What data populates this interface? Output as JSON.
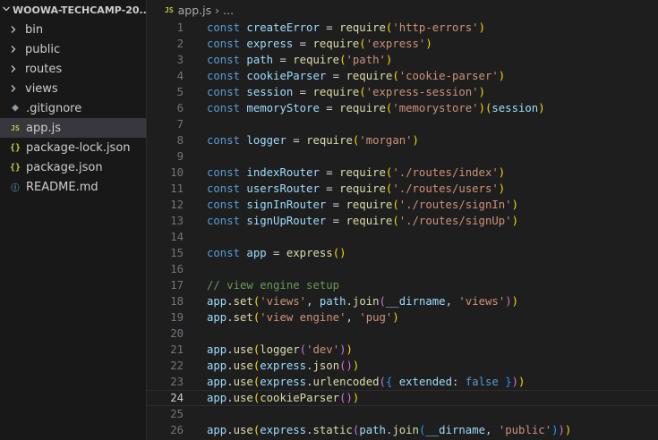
{
  "explorer": {
    "title": "WOOWA-TECHCAMP-20...",
    "items": [
      {
        "kind": "folder",
        "label": "bin"
      },
      {
        "kind": "folder",
        "label": "public"
      },
      {
        "kind": "folder",
        "label": "routes"
      },
      {
        "kind": "folder",
        "label": "views"
      },
      {
        "kind": "file",
        "icon": "git",
        "label": ".gitignore"
      },
      {
        "kind": "file",
        "icon": "js",
        "label": "app.js",
        "selected": true
      },
      {
        "kind": "file",
        "icon": "json",
        "label": "package-lock.json"
      },
      {
        "kind": "file",
        "icon": "json",
        "label": "package.json"
      },
      {
        "kind": "file",
        "icon": "info",
        "label": "README.md"
      }
    ]
  },
  "breadcrumb": {
    "file": "app.js",
    "rest": "..."
  },
  "icon_glyphs": {
    "js": "JS",
    "json": "{}",
    "git": "◆",
    "info": "ⓘ"
  },
  "current_line": 24,
  "code_lines": [
    [
      [
        "kw",
        "const "
      ],
      [
        "var",
        "createError"
      ],
      [
        "op",
        " = "
      ],
      [
        "fn",
        "require"
      ],
      [
        "br1",
        "("
      ],
      [
        "str",
        "'http-errors'"
      ],
      [
        "br1",
        ")"
      ]
    ],
    [
      [
        "kw",
        "const "
      ],
      [
        "var",
        "express"
      ],
      [
        "op",
        " = "
      ],
      [
        "fn",
        "require"
      ],
      [
        "br1",
        "("
      ],
      [
        "str",
        "'express'"
      ],
      [
        "br1",
        ")"
      ]
    ],
    [
      [
        "kw",
        "const "
      ],
      [
        "var",
        "path"
      ],
      [
        "op",
        " = "
      ],
      [
        "fn",
        "require"
      ],
      [
        "br1",
        "("
      ],
      [
        "str",
        "'path'"
      ],
      [
        "br1",
        ")"
      ]
    ],
    [
      [
        "kw",
        "const "
      ],
      [
        "var",
        "cookieParser"
      ],
      [
        "op",
        " = "
      ],
      [
        "fn",
        "require"
      ],
      [
        "br1",
        "("
      ],
      [
        "str",
        "'cookie-parser'"
      ],
      [
        "br1",
        ")"
      ]
    ],
    [
      [
        "kw",
        "const "
      ],
      [
        "var",
        "session"
      ],
      [
        "op",
        " = "
      ],
      [
        "fn",
        "require"
      ],
      [
        "br1",
        "("
      ],
      [
        "str",
        "'express-session'"
      ],
      [
        "br1",
        ")"
      ]
    ],
    [
      [
        "kw",
        "const "
      ],
      [
        "var",
        "memoryStore"
      ],
      [
        "op",
        " = "
      ],
      [
        "fn",
        "require"
      ],
      [
        "br1",
        "("
      ],
      [
        "str",
        "'memorystore'"
      ],
      [
        "br1",
        ")("
      ],
      [
        "var",
        "session"
      ],
      [
        "br1",
        ")"
      ]
    ],
    [],
    [
      [
        "kw",
        "const "
      ],
      [
        "var",
        "logger"
      ],
      [
        "op",
        " = "
      ],
      [
        "fn",
        "require"
      ],
      [
        "br1",
        "("
      ],
      [
        "str",
        "'morgan'"
      ],
      [
        "br1",
        ")"
      ]
    ],
    [],
    [
      [
        "kw",
        "const "
      ],
      [
        "var",
        "indexRouter"
      ],
      [
        "op",
        " = "
      ],
      [
        "fn",
        "require"
      ],
      [
        "br1",
        "("
      ],
      [
        "str",
        "'./routes/index'"
      ],
      [
        "br1",
        ")"
      ]
    ],
    [
      [
        "kw",
        "const "
      ],
      [
        "var",
        "usersRouter"
      ],
      [
        "op",
        " = "
      ],
      [
        "fn",
        "require"
      ],
      [
        "br1",
        "("
      ],
      [
        "str",
        "'./routes/users'"
      ],
      [
        "br1",
        ")"
      ]
    ],
    [
      [
        "kw",
        "const "
      ],
      [
        "var",
        "signInRouter"
      ],
      [
        "op",
        " = "
      ],
      [
        "fn",
        "require"
      ],
      [
        "br1",
        "("
      ],
      [
        "str",
        "'./routes/signIn'"
      ],
      [
        "br1",
        ")"
      ]
    ],
    [
      [
        "kw",
        "const "
      ],
      [
        "var",
        "signUpRouter"
      ],
      [
        "op",
        " = "
      ],
      [
        "fn",
        "require"
      ],
      [
        "br1",
        "("
      ],
      [
        "str",
        "'./routes/signUp'"
      ],
      [
        "br1",
        ")"
      ]
    ],
    [],
    [
      [
        "kw",
        "const "
      ],
      [
        "var",
        "app"
      ],
      [
        "op",
        " = "
      ],
      [
        "fn",
        "express"
      ],
      [
        "br1",
        "()"
      ]
    ],
    [],
    [
      [
        "cm",
        "// view engine setup"
      ]
    ],
    [
      [
        "var",
        "app"
      ],
      [
        "op",
        "."
      ],
      [
        "fn",
        "set"
      ],
      [
        "br1",
        "("
      ],
      [
        "str",
        "'views'"
      ],
      [
        "op",
        ", "
      ],
      [
        "var",
        "path"
      ],
      [
        "op",
        "."
      ],
      [
        "fn",
        "join"
      ],
      [
        "br2",
        "("
      ],
      [
        "var",
        "__dirname"
      ],
      [
        "op",
        ", "
      ],
      [
        "str",
        "'views'"
      ],
      [
        "br2",
        ")"
      ],
      [
        "br1",
        ")"
      ]
    ],
    [
      [
        "var",
        "app"
      ],
      [
        "op",
        "."
      ],
      [
        "fn",
        "set"
      ],
      [
        "br1",
        "("
      ],
      [
        "str",
        "'view engine'"
      ],
      [
        "op",
        ", "
      ],
      [
        "str",
        "'pug'"
      ],
      [
        "br1",
        ")"
      ]
    ],
    [],
    [
      [
        "var",
        "app"
      ],
      [
        "op",
        "."
      ],
      [
        "fn",
        "use"
      ],
      [
        "br1",
        "("
      ],
      [
        "fn",
        "logger"
      ],
      [
        "br2",
        "("
      ],
      [
        "str",
        "'dev'"
      ],
      [
        "br2",
        ")"
      ],
      [
        "br1",
        ")"
      ]
    ],
    [
      [
        "var",
        "app"
      ],
      [
        "op",
        "."
      ],
      [
        "fn",
        "use"
      ],
      [
        "br1",
        "("
      ],
      [
        "var",
        "express"
      ],
      [
        "op",
        "."
      ],
      [
        "fn",
        "json"
      ],
      [
        "br2",
        "()"
      ],
      [
        "br1",
        ")"
      ]
    ],
    [
      [
        "var",
        "app"
      ],
      [
        "op",
        "."
      ],
      [
        "fn",
        "use"
      ],
      [
        "br1",
        "("
      ],
      [
        "var",
        "express"
      ],
      [
        "op",
        "."
      ],
      [
        "fn",
        "urlencoded"
      ],
      [
        "br2",
        "("
      ],
      [
        "br3",
        "{ "
      ],
      [
        "var",
        "extended"
      ],
      [
        "op",
        ": "
      ],
      [
        "kw",
        "false"
      ],
      [
        "br3",
        " }"
      ],
      [
        "br2",
        ")"
      ],
      [
        "br1",
        ")"
      ]
    ],
    [
      [
        "var",
        "app"
      ],
      [
        "op",
        "."
      ],
      [
        "fn",
        "use"
      ],
      [
        "br1",
        "("
      ],
      [
        "fn",
        "cookieParser"
      ],
      [
        "br2",
        "()"
      ],
      [
        "br1",
        ")"
      ]
    ],
    [],
    [
      [
        "var",
        "app"
      ],
      [
        "op",
        "."
      ],
      [
        "fn",
        "use"
      ],
      [
        "br1",
        "("
      ],
      [
        "var",
        "express"
      ],
      [
        "op",
        "."
      ],
      [
        "fn",
        "static"
      ],
      [
        "br2",
        "("
      ],
      [
        "var",
        "path"
      ],
      [
        "op",
        "."
      ],
      [
        "fn",
        "join"
      ],
      [
        "br3",
        "("
      ],
      [
        "var",
        "__dirname"
      ],
      [
        "op",
        ", "
      ],
      [
        "str",
        "'public'"
      ],
      [
        "br3",
        ")"
      ],
      [
        "br2",
        ")"
      ],
      [
        "br1",
        ")"
      ]
    ]
  ]
}
